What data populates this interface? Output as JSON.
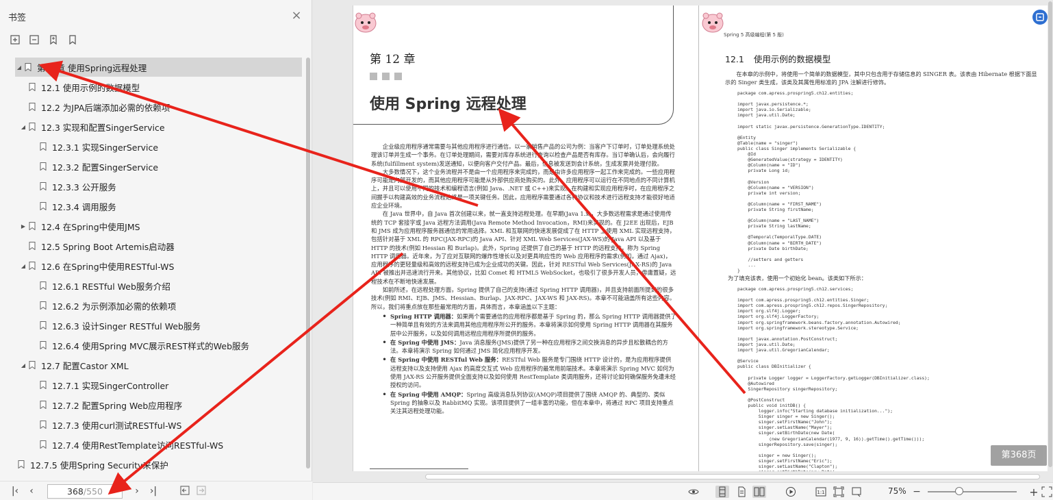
{
  "sidebar": {
    "title": "书签",
    "close_icon": "close-icon",
    "tools": [
      "expand-all-icon",
      "collapse-all-icon",
      "add-bookmark-icon",
      "bookmark-icon"
    ],
    "items": [
      {
        "label": "第12章 使用Spring远程处理",
        "level": 0,
        "toggle": "down",
        "selected": true
      },
      {
        "label": "12.1 使用示例的数据模型",
        "level": 1,
        "toggle": ""
      },
      {
        "label": "12.2 为JPA后端添加必需的依赖项",
        "level": 1,
        "toggle": ""
      },
      {
        "label": "12.3 实现和配置SingerService",
        "level": 1,
        "toggle": "down"
      },
      {
        "label": "12.3.1 实现SingerService",
        "level": 2,
        "toggle": ""
      },
      {
        "label": "12.3.2 配置SingerService",
        "level": 2,
        "toggle": ""
      },
      {
        "label": "12.3.3 公开服务",
        "level": 2,
        "toggle": ""
      },
      {
        "label": "12.3.4 调用服务",
        "level": 2,
        "toggle": ""
      },
      {
        "label": "12.4 在Spring中使用JMS",
        "level": 1,
        "toggle": "right"
      },
      {
        "label": "12.5 Spring Boot Artemis启动器",
        "level": 1,
        "toggle": ""
      },
      {
        "label": "12.6 在Spring中使用RESTful-WS",
        "level": 1,
        "toggle": "down"
      },
      {
        "label": "12.6.1 RESTful Web服务介绍",
        "level": 2,
        "toggle": ""
      },
      {
        "label": "12.6.2 为示例添加必需的依赖项",
        "level": 2,
        "toggle": ""
      },
      {
        "label": "12.6.3 设计Singer RESTful Web服务",
        "level": 2,
        "toggle": ""
      },
      {
        "label": "12.6.4 使用Spring MVC展示REST样式的Web服务",
        "level": 2,
        "toggle": ""
      },
      {
        "label": "12.7 配置Castor XML",
        "level": 1,
        "toggle": "down"
      },
      {
        "label": "12.7.1 实现SingerController",
        "level": 2,
        "toggle": ""
      },
      {
        "label": "12.7.2 配置Spring Web应用程序",
        "level": 2,
        "toggle": ""
      },
      {
        "label": "12.7.3 使用curl测试RESTful-WS",
        "level": 2,
        "toggle": ""
      },
      {
        "label": "12.7.4 使用RestTemplate访问RESTful-WS",
        "level": 2,
        "toggle": ""
      },
      {
        "label": "12.7.5 使用Spring Security来保护",
        "level": 0,
        "toggle": ""
      }
    ]
  },
  "pager": {
    "current": "368",
    "total": "/550"
  },
  "left_page": {
    "chapter_label": "第 12 章",
    "chapter_title": "使用 Spring 远程处理",
    "paragraphs": [
      "企业级应用程序通常需要与其他应用程序进行通信。以一家销售产品的公司为例：当客户下订单时，订单处理系统处理该订单并生成一个事务。在订单处理期间，需要对库存系统进行查询以检查产品是否有库存。当订单确认后，会向履行系统(fulfillment system)发送通知，以便向客户交付产品。最后，信息被发送到会计系统，生成发票并处理付款。",
      "大多数情况下，这个业务流程并不是由一个应用程序来完成的，而是由许多应用程序一起工作来完成的。一些应用程序可能是内部开发的，而其他应用程序可能是从外部供应商处购买的。此外，应用程序可以运行在不同地点的不同计算机上，并且可以使用不同的技术和编程语言(例如 Java、.NET 或 C++)来实现。在构建和实现应用程序时，在应用程序之间握手以构建高效的业务流程始终是一项关键任务。因此，应用程序需要通过各种协议和技术进行远程支持才能很好地适应企业环境。",
      "在 Java 世界中，自 Java 首次创建以来，就一直支持远程处理。在早期(Java 1.x)，大多数远程需求是通过使用传统的 TCP 套接字或 Java 远程方法调用(Java Remote Method Invocation，RMI)来实现的。在 J2EE 出现后，EJB 和 JMS 成为应用程序服务器通信的常用选择。XML 和互联网的快速发展促成了在 HTTP 上使用 XML 实现远程支持，包括针对基于 XML 的 RPC(JAX-RPC)的 Java API、针对 XML Web Services(JAX-WS)的 Java API 以及基于 HTTP 的技术(例如 Hessian 和 Burlap)。此外，Spring 还提供了自己的基于 HTTP 的远程支持，称为 Spring HTTP 调用器。近年来，为了应对互联网的爆炸性增长以及对更具响应性的 Web 应用程序的需求(例如，通过 Ajax)，应用程序的更轻量级和高效的远程支持已成为企业成功的关键。因此，针对 RESTful Web Services(JAX-RS)的 Java API 被推出并迅速流行开来。其他协议，比如 Comet 和 HTML5 WebSocket，也吸引了很多开发人员，毋庸置疑，远程技术在不断地快速发展。",
      "如前所述，在远程处理方面，Spring 提供了自己的支持(通过 Spring HTTP 调用器)，并且支持前面所提到的很多技术(例如 RMI、EJB、JMS、Hessian、Burlap、JAX-RPC、JAX-WS 和 JAX-RS)。本章不可能涵盖所有这些内容。所以，我们将重点放在那些最常用的方面，具体而言，本章涵盖以下主题："
    ],
    "bullets": [
      {
        "head": "Spring HTTP 调用器：",
        "text": "如果两个需要通信的应用程序都是基于 Spring 的，那么 Spring HTTP 调用器提供了一种简单且有效的方法来调用其他应用程序所公开的服务。本章将演示如何使用 Spring HTTP 调用器在其服务层中公开服务，以及如何调用远程应用程序所提供的服务。"
      },
      {
        "head": "在 Spring 中使用 JMS：",
        "text": "Java 消息服务(JMS)提供了另一种在应用程序之间交换消息的异步且松散耦合的方法。本章将演示 Spring 如何通过 JMS 简化应用程序开发。"
      },
      {
        "head": "在 Spring 中使用 RESTful Web 服务：",
        "text": "RESTful Web 服务是专门围绕 HTTP 设计的，是为应用程序提供远程支持以及支持使用 Ajax 的高度交互式 Web 应用程序的最常用前端技术。本章将演示 Spring MVC 如何为使用 JAX-RS 公开服务提供全面支持以及如何使用 RestTemplate 类调用服务，还将讨论如何确保服务免遭未经授权的访问。"
      },
      {
        "head": "在 Spring 中使用 AMQP：",
        "text": "Spring 高级消息队列协议(AMQP)项目提供了围绕 AMQP 的、典型的、类似 Spring 的抽象以及 RabbitMQ 实现。该项目提供了一组丰富的功能，但在本章中，将通过 RPC 项目支持重点关注其远程处理功能。"
      }
    ]
  },
  "right_page": {
    "running_head": "Spring 5 高级编程(第 5 版)",
    "section_num": "12.1",
    "section_title": "使用示例的数据模型",
    "intro": "在本章的示例中，将使用一个简单的数据模型，其中只包含用于存储信息的 SINGER 表。该表由 Hibernate 根据下面显示的 Singer 类生成，该类及其属性用标准的 JPA 注解进行修饰。",
    "code1": "package com.apress.prospring5.ch12.entities;\n\nimport javax.persistence.*;\nimport java.io.Serializable;\nimport java.util.Date;\n\nimport static javax.persistence.GenerationType.IDENTITY;\n\n@Entity\n@Table(name = \"singer\")\npublic class Singer implements Serializable {\n    @Id\n    @GeneratedValue(strategy = IDENTITY)\n    @Column(name = \"ID\")\n    private Long id;\n\n    @Version\n    @Column(name = \"VERSION\")\n    private int version;\n\n    @Column(name = \"FIRST_NAME\")\n    private String firstName;\n\n    @Column(name = \"LAST_NAME\")\n    private String lastName;\n\n    @Temporal(TemporalType.DATE)\n    @Column(name = \"BIRTH_DATE\")\n    private Date birthDate;\n\n    //setters and getters\n    ...\n}",
    "mid_text": "为了填充该表，使用一个初始化 bean。该类如下所示：",
    "code2": "package com.apress.prospring5.ch12.services;\n\nimport com.apress.prospring5.ch12.entities.Singer;\nimport com.apress.prospring5.ch12.repos.SingerRepository;\nimport org.slf4j.Logger;\nimport org.slf4j.LoggerFactory;\nimport org.springframework.beans.factory.annotation.Autowired;\nimport org.springframework.stereotype.Service;\n\nimport javax.annotation.PostConstruct;\nimport java.util.Date;\nimport java.util.GregorianCalendar;\n\n@Service\npublic class DBInitializer {\n\n    private Logger logger = LoggerFactory.getLogger(DBInitializer.class);\n    @Autowired\n    SingerRepository singerRepository;\n\n    @PostConstruct\n    public void initDB() {\n        logger.info(\"Starting database initialization...\");\n        Singer singer = new Singer();\n        singer.setFirstName(\"John\");\n        singer.setLastName(\"Mayer\");\n        singer.setBirthDate(new Date(\n            (new GregorianCalendar(1977, 9, 16)).getTime().getTime()));\n        singerRepository.save(singer);\n\n        singer = new Singer();\n        singer.setFirstName(\"Eric\");\n        singer.setLastName(\"Clapton\");\n        singer.setBirthDate(new Date("
  },
  "page_badge": "第368页",
  "status": {
    "zoom": "75%",
    "zoom_level": 0.35
  },
  "colors": {
    "annotation_arrow": "#e8231b",
    "selection": "#d6d6d6",
    "accent": "#2e6fd1"
  }
}
